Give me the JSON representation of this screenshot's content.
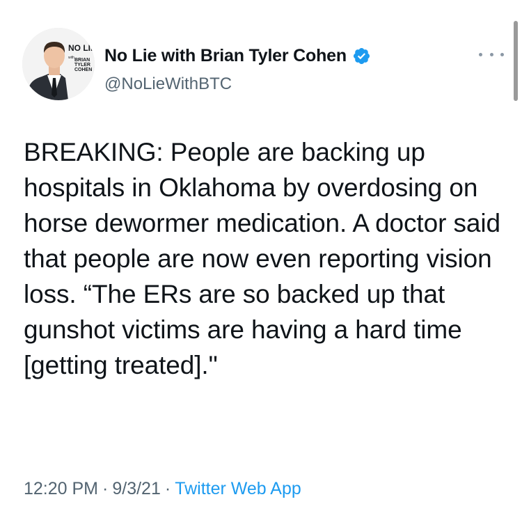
{
  "author": {
    "display_name": "No Lie with Brian Tyler Cohen",
    "handle": "@NoLieWithBTC",
    "avatar_logo_text": [
      "NO LIE",
      "with",
      "BRIAN",
      "TYLER",
      "COHEN"
    ]
  },
  "tweet": {
    "text": "BREAKING: People are backing up hospitals in Oklahoma by overdosing on horse dewormer medication. A doctor said that people are now even reporting vision loss. “The ERs are so backed up that gunshot victims are having a hard time [getting treated].\""
  },
  "meta": {
    "time": "12:20 PM",
    "date": "9/3/21",
    "separator": "·",
    "source": "Twitter Web App"
  },
  "icons": {
    "verified": "verified-badge-icon",
    "more": "more-options-icon"
  },
  "colors": {
    "link": "#1d9bf0",
    "secondary_text": "#536471",
    "primary_text": "#0f1419"
  }
}
